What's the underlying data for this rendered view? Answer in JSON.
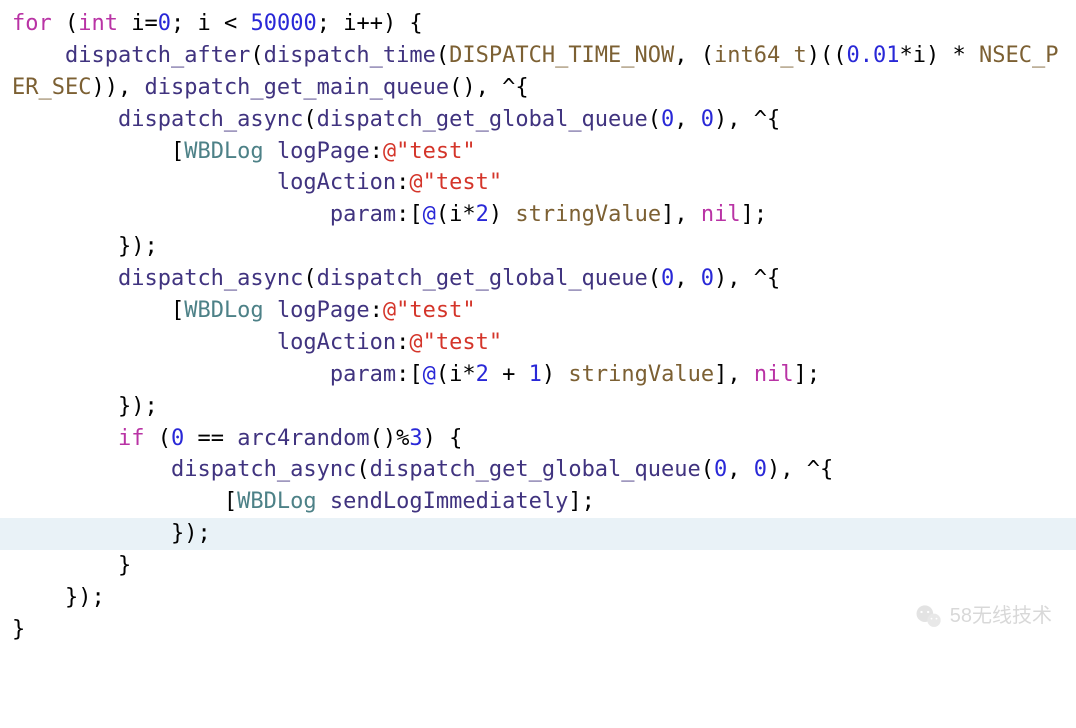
{
  "code": {
    "lines": [
      {
        "indent": 0,
        "segments": [
          {
            "cls": "kw",
            "t": "for"
          },
          {
            "cls": "plain",
            "t": " ("
          },
          {
            "cls": "kw",
            "t": "int"
          },
          {
            "cls": "plain",
            "t": " i="
          },
          {
            "cls": "num",
            "t": "0"
          },
          {
            "cls": "plain",
            "t": "; i < "
          },
          {
            "cls": "num",
            "t": "50000"
          },
          {
            "cls": "plain",
            "t": "; i++) {"
          }
        ]
      },
      {
        "indent": 1,
        "segments": [
          {
            "cls": "fn",
            "t": "dispatch_after"
          },
          {
            "cls": "plain",
            "t": "("
          },
          {
            "cls": "fn",
            "t": "dispatch_time"
          },
          {
            "cls": "plain",
            "t": "("
          },
          {
            "cls": "macro",
            "t": "DISPATCH_TIME_NOW"
          },
          {
            "cls": "plain",
            "t": ", ("
          },
          {
            "cls": "type",
            "t": "int64_t"
          },
          {
            "cls": "plain",
            "t": ")(("
          },
          {
            "cls": "num",
            "t": "0.01"
          },
          {
            "cls": "plain",
            "t": "*i) * "
          },
          {
            "cls": "macro",
            "t": "NSEC_PER_SEC"
          },
          {
            "cls": "plain",
            "t": ")), "
          },
          {
            "cls": "fn",
            "t": "dispatch_get_main_queue"
          },
          {
            "cls": "plain",
            "t": "(), ^{"
          }
        ]
      },
      {
        "indent": 2,
        "segments": [
          {
            "cls": "fn",
            "t": "dispatch_async"
          },
          {
            "cls": "plain",
            "t": "("
          },
          {
            "cls": "fn",
            "t": "dispatch_get_global_queue"
          },
          {
            "cls": "plain",
            "t": "("
          },
          {
            "cls": "num",
            "t": "0"
          },
          {
            "cls": "plain",
            "t": ", "
          },
          {
            "cls": "num",
            "t": "0"
          },
          {
            "cls": "plain",
            "t": "), ^{"
          }
        ]
      },
      {
        "indent": 3,
        "segments": [
          {
            "cls": "plain",
            "t": "["
          },
          {
            "cls": "cls",
            "t": "WBDLog"
          },
          {
            "cls": "plain",
            "t": " "
          },
          {
            "cls": "fn",
            "t": "logPage"
          },
          {
            "cls": "plain",
            "t": ":"
          },
          {
            "cls": "str",
            "t": "@\"test\""
          }
        ]
      },
      {
        "indent": 5,
        "segments": [
          {
            "cls": "fn",
            "t": "logAction"
          },
          {
            "cls": "plain",
            "t": ":"
          },
          {
            "cls": "str",
            "t": "@\"test\""
          }
        ]
      },
      {
        "indent": 6,
        "segments": [
          {
            "cls": "fn",
            "t": "param"
          },
          {
            "cls": "plain",
            "t": ":["
          },
          {
            "cls": "num",
            "t": "@"
          },
          {
            "cls": "plain",
            "t": "(i*"
          },
          {
            "cls": "num",
            "t": "2"
          },
          {
            "cls": "plain",
            "t": ") "
          },
          {
            "cls": "type",
            "t": "stringValue"
          },
          {
            "cls": "plain",
            "t": "], "
          },
          {
            "cls": "nil",
            "t": "nil"
          },
          {
            "cls": "plain",
            "t": "];"
          }
        ]
      },
      {
        "indent": 2,
        "segments": [
          {
            "cls": "plain",
            "t": "});"
          }
        ]
      },
      {
        "indent": 2,
        "segments": [
          {
            "cls": "fn",
            "t": "dispatch_async"
          },
          {
            "cls": "plain",
            "t": "("
          },
          {
            "cls": "fn",
            "t": "dispatch_get_global_queue"
          },
          {
            "cls": "plain",
            "t": "("
          },
          {
            "cls": "num",
            "t": "0"
          },
          {
            "cls": "plain",
            "t": ", "
          },
          {
            "cls": "num",
            "t": "0"
          },
          {
            "cls": "plain",
            "t": "), ^{"
          }
        ]
      },
      {
        "indent": 3,
        "segments": [
          {
            "cls": "plain",
            "t": "["
          },
          {
            "cls": "cls",
            "t": "WBDLog"
          },
          {
            "cls": "plain",
            "t": " "
          },
          {
            "cls": "fn",
            "t": "logPage"
          },
          {
            "cls": "plain",
            "t": ":"
          },
          {
            "cls": "str",
            "t": "@\"test\""
          }
        ]
      },
      {
        "indent": 5,
        "segments": [
          {
            "cls": "fn",
            "t": "logAction"
          },
          {
            "cls": "plain",
            "t": ":"
          },
          {
            "cls": "str",
            "t": "@\"test\""
          }
        ]
      },
      {
        "indent": 6,
        "segments": [
          {
            "cls": "fn",
            "t": "param"
          },
          {
            "cls": "plain",
            "t": ":["
          },
          {
            "cls": "num",
            "t": "@"
          },
          {
            "cls": "plain",
            "t": "(i*"
          },
          {
            "cls": "num",
            "t": "2"
          },
          {
            "cls": "plain",
            "t": " + "
          },
          {
            "cls": "num",
            "t": "1"
          },
          {
            "cls": "plain",
            "t": ") "
          },
          {
            "cls": "type",
            "t": "stringValue"
          },
          {
            "cls": "plain",
            "t": "], "
          },
          {
            "cls": "nil",
            "t": "nil"
          },
          {
            "cls": "plain",
            "t": "];"
          }
        ]
      },
      {
        "indent": 2,
        "segments": [
          {
            "cls": "plain",
            "t": "});"
          }
        ]
      },
      {
        "indent": 2,
        "segments": [
          {
            "cls": "kw",
            "t": "if"
          },
          {
            "cls": "plain",
            "t": " ("
          },
          {
            "cls": "num",
            "t": "0"
          },
          {
            "cls": "plain",
            "t": " == "
          },
          {
            "cls": "fn",
            "t": "arc4random"
          },
          {
            "cls": "plain",
            "t": "()%"
          },
          {
            "cls": "num",
            "t": "3"
          },
          {
            "cls": "plain",
            "t": ") {"
          }
        ]
      },
      {
        "indent": 3,
        "segments": [
          {
            "cls": "fn",
            "t": "dispatch_async"
          },
          {
            "cls": "plain",
            "t": "("
          },
          {
            "cls": "fn",
            "t": "dispatch_get_global_queue"
          },
          {
            "cls": "plain",
            "t": "("
          },
          {
            "cls": "num",
            "t": "0"
          },
          {
            "cls": "plain",
            "t": ", "
          },
          {
            "cls": "num",
            "t": "0"
          },
          {
            "cls": "plain",
            "t": "), ^{"
          }
        ]
      },
      {
        "indent": 4,
        "segments": [
          {
            "cls": "plain",
            "t": "["
          },
          {
            "cls": "cls",
            "t": "WBDLog"
          },
          {
            "cls": "plain",
            "t": " "
          },
          {
            "cls": "fn",
            "t": "sendLogImmediately"
          },
          {
            "cls": "plain",
            "t": "];"
          }
        ]
      },
      {
        "indent": 3,
        "highlight": true,
        "segments": [
          {
            "cls": "plain",
            "t": "});"
          }
        ]
      },
      {
        "indent": 2,
        "segments": [
          {
            "cls": "plain",
            "t": "}"
          }
        ]
      },
      {
        "indent": 1,
        "segments": [
          {
            "cls": "plain",
            "t": "});"
          }
        ]
      },
      {
        "indent": 0,
        "segments": [
          {
            "cls": "plain",
            "t": "}"
          }
        ]
      }
    ]
  },
  "watermark": {
    "text": "58无线技术"
  }
}
